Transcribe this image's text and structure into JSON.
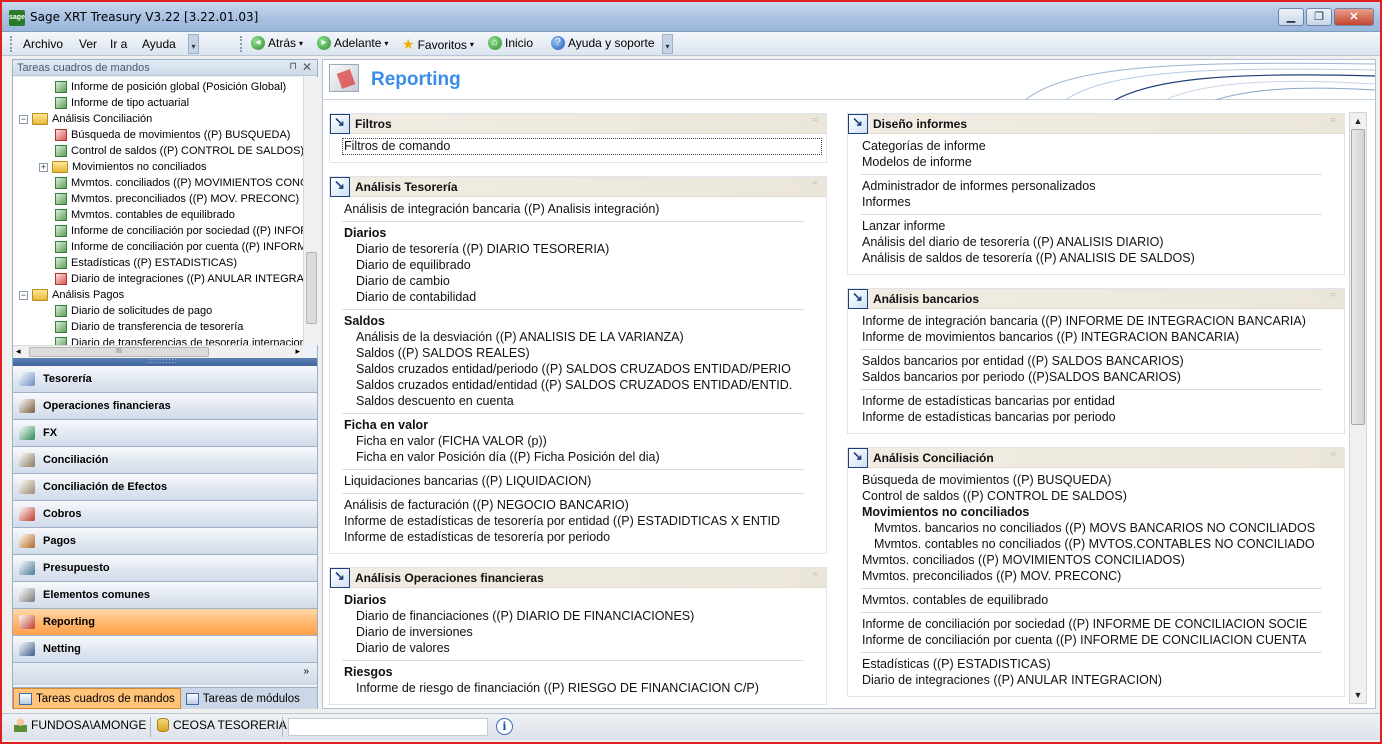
{
  "window": {
    "title": "Sage XRT Treasury V3.22  [3.22.01.03]",
    "app_badge": "sage",
    "buttons": {
      "minimize": "▁",
      "restore": "❐",
      "close": "✕"
    }
  },
  "menu": {
    "items": [
      "Archivo",
      "Ver",
      "Ir a",
      "Ayuda"
    ],
    "nav": {
      "back": "Atrás",
      "forward": "Adelante",
      "favorites": "Favoritos",
      "home": "Inicio",
      "help": "Ayuda y soporte"
    }
  },
  "left_panel": {
    "title": "Tareas cuadros de mandos",
    "pin": "⊓",
    "close": "✕",
    "tree": [
      {
        "label": "Informe de posición global (Posición Global)",
        "kind": "leaf"
      },
      {
        "label": "Informe de tipo actuarial",
        "kind": "leaf"
      },
      {
        "label": "Análisis Conciliación",
        "kind": "folder",
        "expander": "−"
      },
      {
        "label": "Búsqueda de movimientos ((P) BUSQUEDA)",
        "kind": "leaf-red"
      },
      {
        "label": "Control de saldos ((P) CONTROL DE SALDOS)",
        "kind": "leaf"
      },
      {
        "label": "Movimientos no conciliados",
        "kind": "folder",
        "expander": "+"
      },
      {
        "label": "Mvmtos. conciliados ((P) MOVIMIENTOS CONC",
        "kind": "leaf"
      },
      {
        "label": "Mvmtos. preconciliados ((P) MOV. PRECONC)",
        "kind": "leaf"
      },
      {
        "label": "Mvmtos. contables de equilibrado",
        "kind": "leaf"
      },
      {
        "label": "Informe de conciliación por sociedad ((P) INFOR",
        "kind": "leaf"
      },
      {
        "label": "Informe de conciliación por cuenta ((P) INFORM",
        "kind": "leaf"
      },
      {
        "label": "Estadísticas ((P) ESTADISTICAS)",
        "kind": "leaf"
      },
      {
        "label": "Diario de integraciones ((P) ANULAR INTEGRA",
        "kind": "leaf-red"
      },
      {
        "label": "Análisis Pagos",
        "kind": "folder",
        "expander": "−"
      },
      {
        "label": "Diario de solicitudes de pago",
        "kind": "leaf"
      },
      {
        "label": "Diario de transferencia de tesorería",
        "kind": "leaf"
      },
      {
        "label": "Diario de transferencias de tesorería internacion",
        "kind": "leaf"
      }
    ],
    "hscroll_left": "◂",
    "hscroll_right": "▸",
    "hscroll_grip": "III",
    "splitter_grip": "::::::::::",
    "modules": [
      {
        "label": "Tesorería",
        "icon": "treasury-icon",
        "color": "#6a8fc0"
      },
      {
        "label": "Operaciones financieras",
        "icon": "handshake-icon",
        "color": "#7a5a3a"
      },
      {
        "label": "FX",
        "icon": "fx-icon",
        "color": "#2e8b57"
      },
      {
        "label": "Conciliación",
        "icon": "reconciliation-icon",
        "color": "#8a7a60"
      },
      {
        "label": "Conciliación de Efectos",
        "icon": "bills-reconciliation-icon",
        "color": "#9a8a70"
      },
      {
        "label": "Cobros",
        "icon": "collections-icon",
        "color": "#c0392b"
      },
      {
        "label": "Pagos",
        "icon": "payments-icon",
        "color": "#b5651d"
      },
      {
        "label": "Presupuesto",
        "icon": "budget-icon",
        "color": "#4a7a9a"
      },
      {
        "label": "Elementos comunes",
        "icon": "common-elements-icon",
        "color": "#7a7a7a"
      },
      {
        "label": "Reporting",
        "icon": "reporting-icon",
        "color": "#c0392b",
        "active": true
      },
      {
        "label": "Netting",
        "icon": "netting-icon",
        "color": "#3a5a8a"
      }
    ],
    "more": "»",
    "bottom_tabs": [
      {
        "label": "Tareas cuadros de mandos",
        "active": true
      },
      {
        "label": "Tareas de módulos",
        "active": false
      }
    ]
  },
  "main": {
    "title": "Reporting",
    "collapse_glyph": "≈",
    "scroll": {
      "up": "▲",
      "down": "▼"
    },
    "left_groups": [
      {
        "title": "Filtros",
        "items": [
          {
            "text": "Filtros de comando",
            "level": 0,
            "focus": true
          }
        ]
      },
      {
        "title": "Análisis Tesorería",
        "items": [
          {
            "text": "Análisis de integración bancaria ((P) Analisis integración)",
            "level": 0
          },
          {
            "sep": true
          },
          {
            "text": "Diarios",
            "level": 0,
            "bold": true
          },
          {
            "text": "Diario de tesorería ((P) DIARIO TESORERIA)",
            "level": 1
          },
          {
            "text": "Diario de equilibrado",
            "level": 1
          },
          {
            "text": "Diario de cambio",
            "level": 1
          },
          {
            "text": "Diario de contabilidad",
            "level": 1
          },
          {
            "sep": true
          },
          {
            "text": "Saldos",
            "level": 0,
            "bold": true
          },
          {
            "text": "Análisis de la desviación ((P) ANALISIS DE LA VARIANZA)",
            "level": 1
          },
          {
            "text": "Saldos ((P) SALDOS REALES)",
            "level": 1
          },
          {
            "text": "Saldos cruzados entidad/periodo ((P) SALDOS CRUZADOS ENTIDAD/PERIO",
            "level": 1
          },
          {
            "text": "Saldos cruzados entidad/entidad ((P) SALDOS CRUZADOS ENTIDAD/ENTID.",
            "level": 1
          },
          {
            "text": "Saldos descuento en cuenta",
            "level": 1
          },
          {
            "sep": true
          },
          {
            "text": "Ficha en valor",
            "level": 0,
            "bold": true
          },
          {
            "text": "Ficha en valor  (FICHA VALOR (p))",
            "level": 1
          },
          {
            "text": "Ficha en valor Posición día ((P) Ficha Posición del dia)",
            "level": 1
          },
          {
            "sep": true
          },
          {
            "text": "Liquidaciones bancarias ((P) LIQUIDACION)",
            "level": 0
          },
          {
            "sep": true
          },
          {
            "text": "Análisis de facturación ((P) NEGOCIO BANCARIO)",
            "level": 0
          },
          {
            "text": "Informe de estadísticas de tesorería por entidad ((P) ESTADIDTICAS X ENTID",
            "level": 0
          },
          {
            "text": "Informe de estadísticas de tesorería por periodo",
            "level": 0
          }
        ]
      },
      {
        "title": "Análisis Operaciones financieras",
        "items": [
          {
            "text": "Diarios",
            "level": 0,
            "bold": true
          },
          {
            "text": "Diario de financiaciones ((P) DIARIO DE FINANCIACIONES)",
            "level": 1
          },
          {
            "text": "Diario de inversiones",
            "level": 1
          },
          {
            "text": "Diario de valores",
            "level": 1
          },
          {
            "sep": true
          },
          {
            "text": "Riesgos",
            "level": 0,
            "bold": true
          },
          {
            "text": "Informe de riesgo de financiación ((P) RIESGO DE FINANCIACION C/P)",
            "level": 1
          }
        ]
      }
    ],
    "right_groups": [
      {
        "title": "Diseño informes",
        "items": [
          {
            "text": "Categorías de informe",
            "level": 0
          },
          {
            "text": "Modelos de informe",
            "level": 0
          },
          {
            "sep": true
          },
          {
            "text": "Administrador de informes personalizados",
            "level": 0
          },
          {
            "text": "Informes",
            "level": 0
          },
          {
            "sep": true
          },
          {
            "text": "Lanzar informe",
            "level": 0
          },
          {
            "text": "Análisis del diario de tesorería ((P) ANALISIS DIARIO)",
            "level": 0
          },
          {
            "text": "Análisis de saldos de tesorería ((P) ANALISIS DE SALDOS)",
            "level": 0
          }
        ]
      },
      {
        "title": "Análisis bancarios",
        "items": [
          {
            "text": "Informe de integración bancaria ((P) INFORME DE INTEGRACION BANCARIA)",
            "level": 0
          },
          {
            "text": "Informe de movimientos bancarios ((P) INTEGRACION BANCARIA)",
            "level": 0
          },
          {
            "sep": true
          },
          {
            "text": "Saldos bancarios por entidad ((P) SALDOS BANCARIOS)",
            "level": 0
          },
          {
            "text": "Saldos bancarios por periodo ((P)SALDOS BANCARIOS)",
            "level": 0
          },
          {
            "sep": true
          },
          {
            "text": "Informe de estadísticas bancarias por entidad",
            "level": 0
          },
          {
            "text": "Informe de estadísticas bancarias por periodo",
            "level": 0
          }
        ]
      },
      {
        "title": "Análisis Conciliación",
        "items": [
          {
            "text": "Búsqueda de movimientos ((P) BUSQUEDA)",
            "level": 0
          },
          {
            "text": "Control de saldos ((P) CONTROL DE SALDOS)",
            "level": 0
          },
          {
            "text": "Movimientos no conciliados",
            "level": 0,
            "bold": true
          },
          {
            "text": "Mvmtos. bancarios no conciliados ((P) MOVS BANCARIOS NO CONCILIADOS",
            "level": 1
          },
          {
            "text": "Mvmtos. contables no conciliados ((P) MVTOS.CONTABLES NO CONCILIADO",
            "level": 1
          },
          {
            "text": "Mvmtos. conciliados ((P) MOVIMIENTOS CONCILIADOS)",
            "level": 0
          },
          {
            "text": "Mvmtos. preconciliados ((P) MOV. PRECONC)",
            "level": 0
          },
          {
            "sep": true
          },
          {
            "text": "Mvmtos. contables de equilibrado",
            "level": 0
          },
          {
            "sep": true
          },
          {
            "text": "Informe de conciliación por sociedad ((P) INFORME DE CONCILIACION SOCIE",
            "level": 0
          },
          {
            "text": "Informe de conciliación por cuenta ((P) INFORME DE CONCILIACION CUENTA",
            "level": 0
          },
          {
            "sep": true
          },
          {
            "text": "Estadísticas ((P) ESTADISTICAS)",
            "level": 0
          },
          {
            "text": "Diario de integraciones ((P) ANULAR INTEGRACION)",
            "level": 0
          }
        ]
      }
    ]
  },
  "status": {
    "user": "FUNDOSA\\AMONGE",
    "company": "CEOSA TESORERIA",
    "search_value": "",
    "info": "i"
  }
}
